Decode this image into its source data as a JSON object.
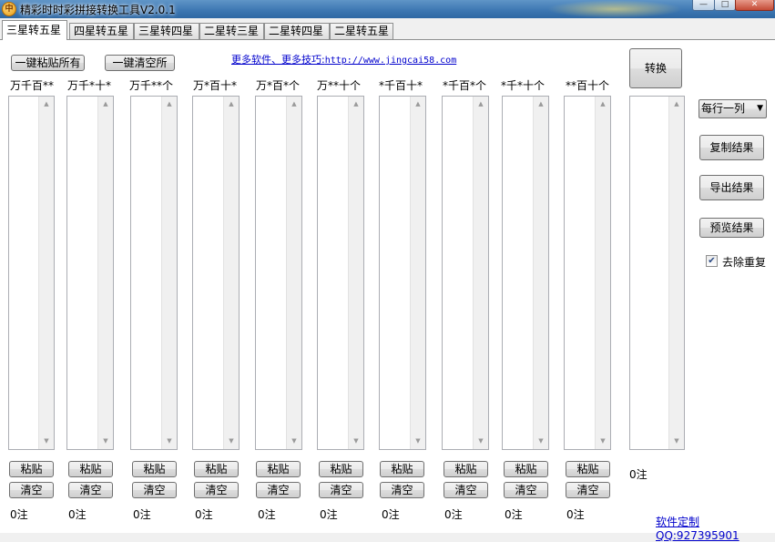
{
  "window": {
    "title": "精彩时时彩拼接转换工具V2.0.1",
    "icon": "lottery-coin-icon"
  },
  "tabs": [
    {
      "label": "三星转五星",
      "active": true
    },
    {
      "label": "四星转五星"
    },
    {
      "label": "三星转四星"
    },
    {
      "label": "二星转三星"
    },
    {
      "label": "二星转四星"
    },
    {
      "label": "二星转五星"
    }
  ],
  "toolbar": {
    "paste_all": "一键粘贴所有",
    "clear_all": "一键清空所",
    "link_text": "更多软件、更多技巧:",
    "link_url": "http://www.jingcai58.com",
    "convert": "转换"
  },
  "columns": [
    {
      "header": "万千百**",
      "paste": "粘贴",
      "clear": "清空",
      "count": "0注"
    },
    {
      "header": "万千*十*",
      "paste": "粘贴",
      "clear": "清空",
      "count": "0注"
    },
    {
      "header": "万千**个",
      "paste": "粘贴",
      "clear": "清空",
      "count": "0注"
    },
    {
      "header": "万*百十*",
      "paste": "粘贴",
      "clear": "清空",
      "count": "0注"
    },
    {
      "header": "万*百*个",
      "paste": "粘贴",
      "clear": "清空",
      "count": "0注"
    },
    {
      "header": "万**十个",
      "paste": "粘贴",
      "clear": "清空",
      "count": "0注"
    },
    {
      "header": "*千百十*",
      "paste": "粘贴",
      "clear": "清空",
      "count": "0注"
    },
    {
      "header": "*千百*个",
      "paste": "粘贴",
      "clear": "清空",
      "count": "0注"
    },
    {
      "header": "*千*十个",
      "paste": "粘贴",
      "clear": "清空",
      "count": "0注"
    },
    {
      "header": "**百十个",
      "paste": "粘贴",
      "clear": "清空",
      "count": "0注"
    }
  ],
  "result": {
    "count": "0注",
    "format_selected": "每行一列",
    "copy": "复制结果",
    "export": "导出结果",
    "preview": "预览结果",
    "dedupe_label": "去除重复",
    "dedupe_checked": true
  },
  "footer": {
    "custom_link": "软件定制QQ:927395901"
  }
}
